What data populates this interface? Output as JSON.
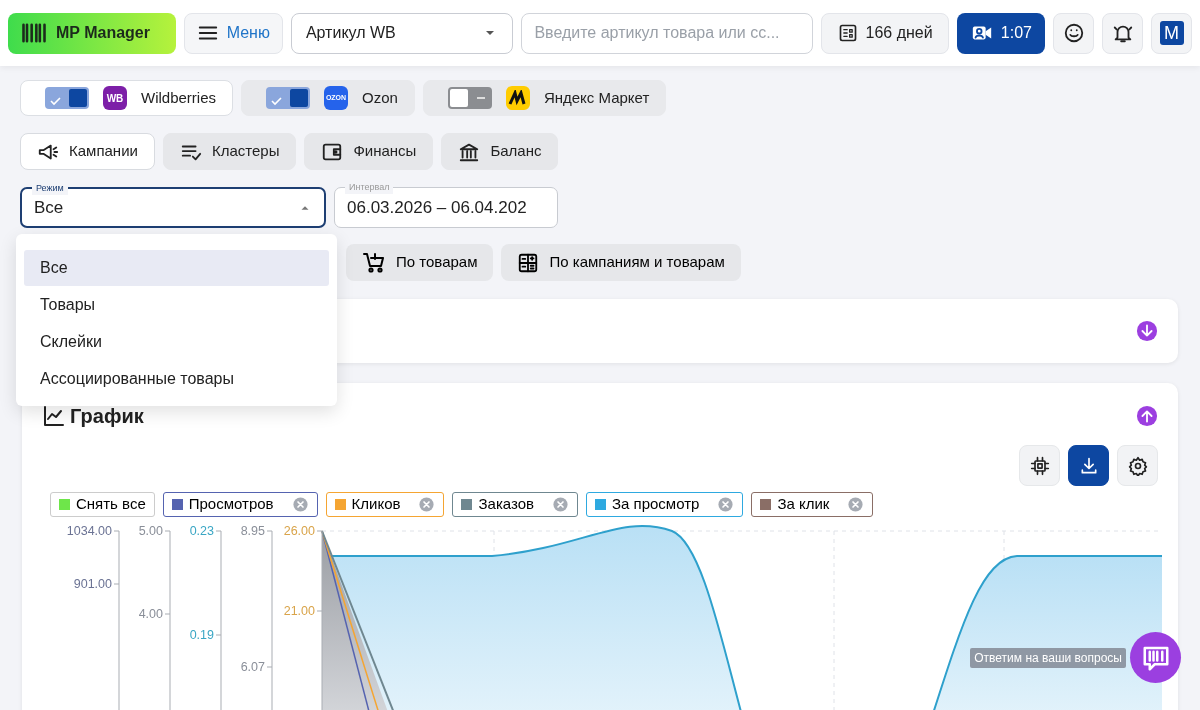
{
  "header": {
    "logo": "MP Manager",
    "menu": "Меню",
    "article_select": "Артикул WB",
    "search": {
      "placeholder": "Введите артикул товара или сс..."
    },
    "days": "166 дней",
    "video": "1:07",
    "avatar": "M"
  },
  "marketplaces": [
    {
      "label": "Wildberries",
      "logo": "WB",
      "checked": true,
      "selected": true
    },
    {
      "label": "Ozon",
      "logo": "OZON",
      "checked": true,
      "selected": false
    },
    {
      "label": "Яндекс Маркет",
      "checked": false,
      "selected": false
    }
  ],
  "tabs": [
    {
      "label": "Кампании",
      "selected": true
    },
    {
      "label": "Кластеры",
      "selected": false
    },
    {
      "label": "Финансы",
      "selected": false
    },
    {
      "label": "Баланс",
      "selected": false
    }
  ],
  "mode_field": {
    "label": "Режим",
    "value": "Все",
    "expanded": true
  },
  "interval_field": {
    "label": "Интервал",
    "value": "06.03.2026 – 06.04.202"
  },
  "mode_dropdown": {
    "options": [
      {
        "label": "Все",
        "selected": true
      },
      {
        "label": "Товары",
        "selected": false
      },
      {
        "label": "Склейки",
        "selected": false
      },
      {
        "label": "Ассоциированные товары",
        "selected": false
      }
    ]
  },
  "group_buttons": [
    {
      "label": "По товарам"
    },
    {
      "label": "По кампаниям и товарам"
    }
  ],
  "collapsed_card": {
    "expanded": false
  },
  "chart_card": {
    "title": "График",
    "expanded": true,
    "legend": [
      {
        "label": "Снять все",
        "color": "#6ee64a",
        "kind": "toggle-all"
      },
      {
        "label": "Просмотров",
        "color": "#5563b0",
        "kind": "series"
      },
      {
        "label": "Кликов",
        "color": "#f5a532",
        "kind": "series"
      },
      {
        "label": "Заказов",
        "color": "#6f8790",
        "kind": "series"
      },
      {
        "label": "За просмотр",
        "color": "#2ea9e0",
        "kind": "series"
      },
      {
        "label": "За клик",
        "color": "#8a6e66",
        "kind": "series"
      }
    ],
    "axes": [
      {
        "color": "#6b7394",
        "ticks": [
          "1034.00",
          "901.00"
        ]
      },
      {
        "color": "#8a8f99",
        "ticks": [
          "5.00",
          "4.00"
        ]
      },
      {
        "color": "#3aa6c4",
        "ticks": [
          "0.23",
          "0.19"
        ]
      },
      {
        "color": "#8a8f99",
        "ticks": [
          "8.95",
          "6.07"
        ]
      },
      {
        "color": "#d9a44a",
        "ticks": [
          "26.00",
          "21.00"
        ]
      }
    ]
  },
  "chat": {
    "tooltip": "Ответим на ваши вопросы"
  }
}
